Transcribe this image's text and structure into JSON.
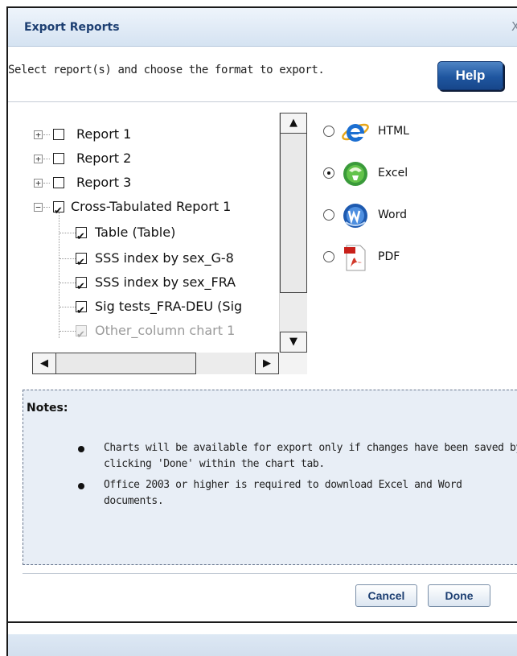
{
  "window": {
    "title": "Export Reports",
    "close_label": "X"
  },
  "instruction": "Select report(s) and choose the format to export.",
  "help_label": "Help",
  "tree": {
    "items": [
      {
        "label": "Report 1",
        "checked": false,
        "expander": "+"
      },
      {
        "label": "Report 2",
        "checked": false,
        "expander": "+"
      },
      {
        "label": "Report 3",
        "checked": false,
        "expander": "+"
      },
      {
        "label": "Cross-Tabulated Report 1",
        "checked": true,
        "expander": "−"
      },
      {
        "label": "Table (Table)",
        "checked": true
      },
      {
        "label": "SSS index by sex_G-8",
        "checked": true
      },
      {
        "label": "SSS index by sex_FRA",
        "checked": true
      },
      {
        "label": "Sig tests_FRA-DEU (Sig",
        "checked": true
      },
      {
        "label": "Other_column chart 1",
        "checked": true,
        "disabled": true
      }
    ]
  },
  "scroll": {
    "up": "▲",
    "down": "▼",
    "left": "◀",
    "right": "▶"
  },
  "formats": [
    {
      "label": "HTML",
      "icon": "ie-icon",
      "selected": false
    },
    {
      "label": "Excel",
      "icon": "excel-icon",
      "selected": true
    },
    {
      "label": "Word",
      "icon": "word-icon",
      "selected": false
    },
    {
      "label": "PDF",
      "icon": "pdf-icon",
      "selected": false
    }
  ],
  "notes": {
    "title": "Notes:",
    "items": [
      "Charts will be available for export only if changes have been saved by clicking 'Done' within the chart tab.",
      "Office 2003 or higher is required to download Excel and Word documents."
    ]
  },
  "buttons": {
    "cancel": "Cancel",
    "done": "Done"
  }
}
